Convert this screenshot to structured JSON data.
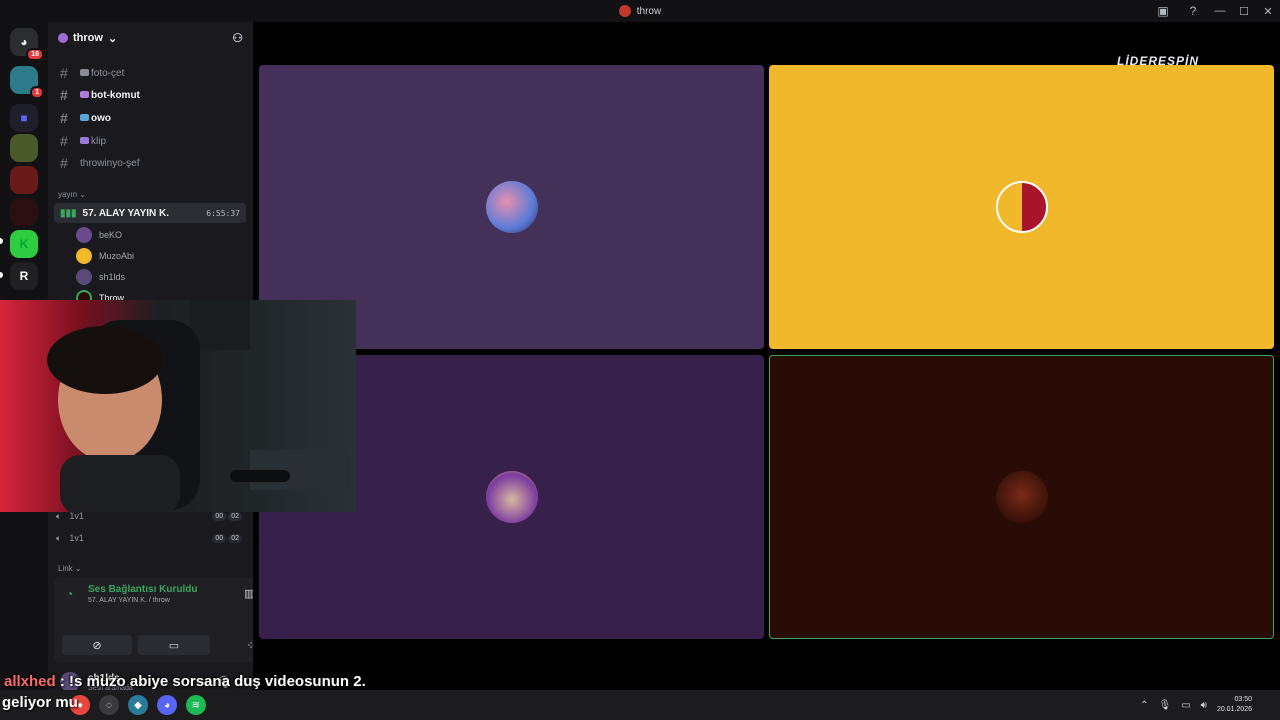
{
  "window": {
    "title": "throw"
  },
  "guilds": {
    "dm_badge": "16",
    "server2_badge": "1",
    "letter_server": "R"
  },
  "server": {
    "name": "throw"
  },
  "channels": [
    {
      "name": "foto-çet",
      "bold": false
    },
    {
      "name": "bot-komut",
      "bold": true
    },
    {
      "name": "owo",
      "bold": true
    },
    {
      "name": "klip",
      "bold": false
    },
    {
      "name": "throwinyo-şef",
      "bold": false
    }
  ],
  "category_yayin": "yayın",
  "voice_channel": {
    "name": "57. ALAY YAYIN K.",
    "timer": "6:55:37"
  },
  "voice_users": [
    "beKO",
    "MuzoAbi",
    "sh1lds",
    "Throw"
  ],
  "voice_channels_other": [
    {
      "name": "1v1",
      "count_a": "00",
      "count_b": "02"
    },
    {
      "name": "1v1",
      "count_a": "00",
      "count_b": "02"
    }
  ],
  "category_link": "Link",
  "voice_panel": {
    "status": "Ses Bağlantısı Kuruldu",
    "sub": "57. ALAY YAYIN K. / throw"
  },
  "user_panel": {
    "name": "sh1lds",
    "status": "Sesli aramada"
  },
  "stage": {
    "watermark": "LİDERESPİN"
  },
  "chat_overlay": {
    "user": "allxhed",
    "message": " : !s muzo abiye sorsana duş videosunun 2."
  },
  "taskbar": {
    "left_text": "geliyor mu",
    "time": "03:50",
    "date": "20.01.2026"
  },
  "colors": {
    "tile1": "#443159",
    "tile2": "#f0b82a",
    "tile3": "#37204a",
    "tile4": "#2a0c06",
    "speaking_border": "#3ba55d"
  }
}
